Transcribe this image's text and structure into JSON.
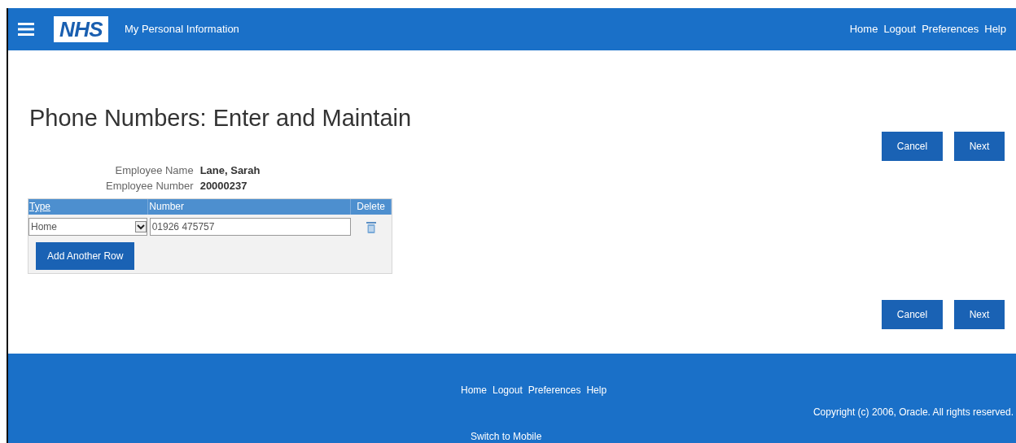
{
  "header": {
    "logo": "NHS",
    "title": "My Personal Information",
    "links": [
      "Home",
      "Logout",
      "Preferences",
      "Help"
    ]
  },
  "page_title": "Phone Numbers: Enter and Maintain",
  "top_buttons": [
    "Cancel",
    "Next"
  ],
  "employee": [
    {
      "label": "Employee Name",
      "value": "Lane, Sarah"
    },
    {
      "label": "Employee Number",
      "value": "20000237"
    }
  ],
  "table": {
    "columns": [
      "Type",
      "Number",
      "Delete"
    ],
    "rows": [
      {
        "type": "Home",
        "number": "01926 475757"
      }
    ],
    "add_button": "Add Another Row"
  },
  "bottom_buttons": [
    "Cancel",
    "Next"
  ],
  "footer": {
    "links": [
      "Home",
      "Logout",
      "Preferences",
      "Help"
    ],
    "copyright": "Copyright (c) 2006, Oracle. All rights reserved.",
    "switch_link": "Switch to Mobile"
  }
}
